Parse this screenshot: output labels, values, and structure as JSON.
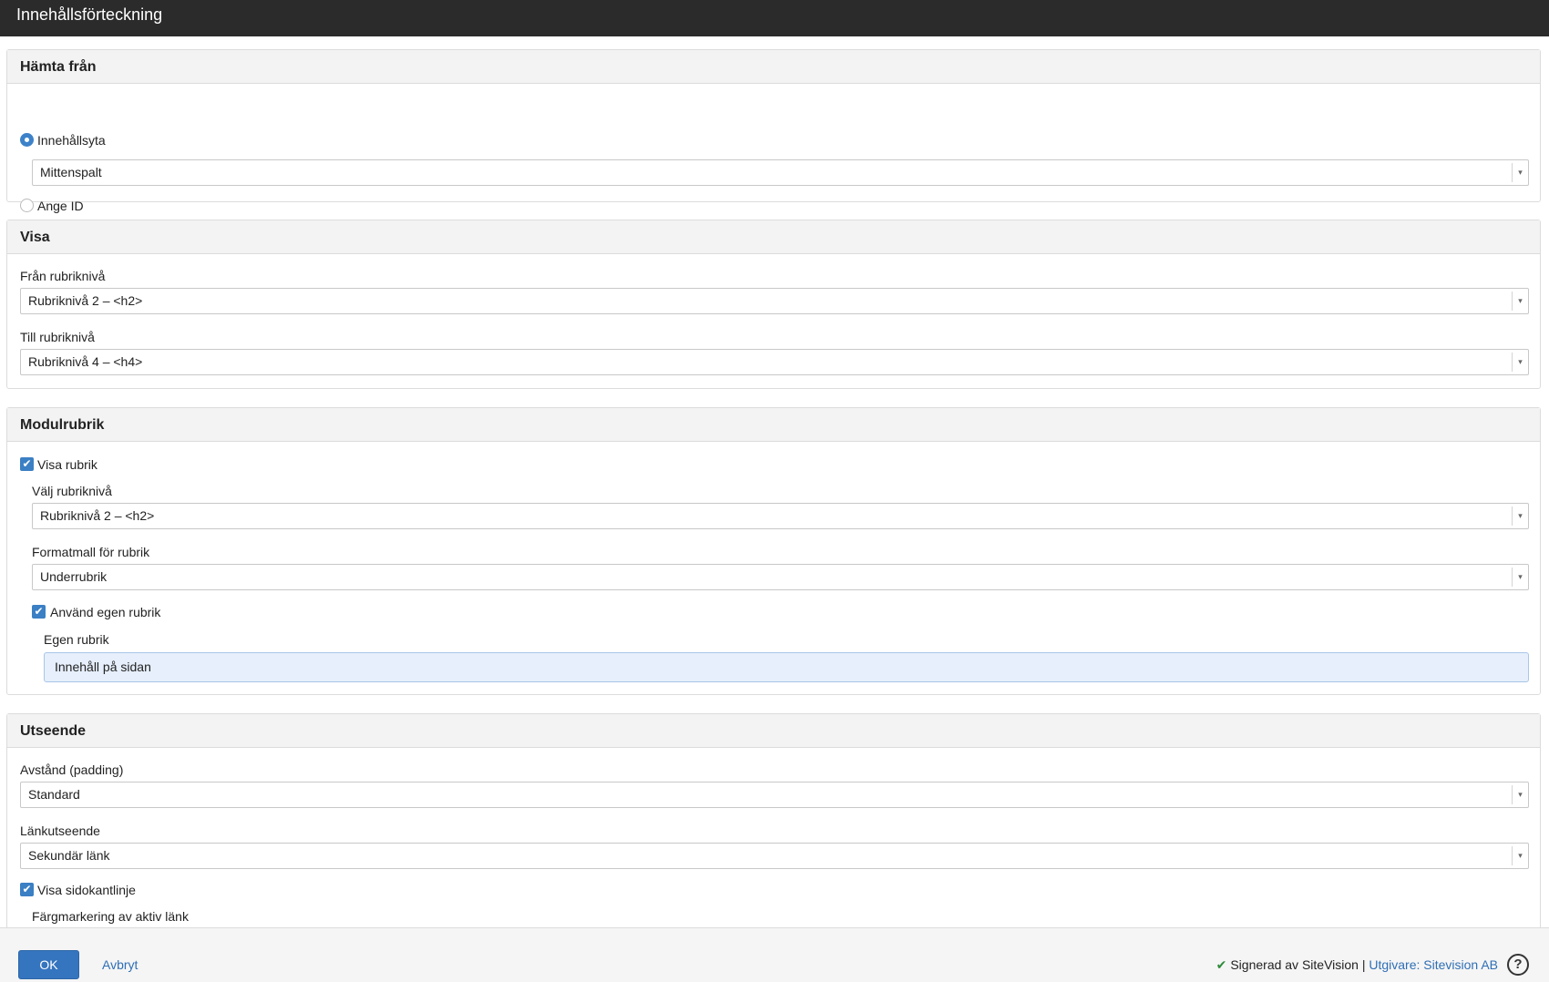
{
  "window": {
    "title": "Innehållsförteckning"
  },
  "source": {
    "heading": "Hämta från",
    "option_area_label": "Innehållsyta",
    "area_select_value": "Mittenspalt",
    "option_id_label": "Ange ID"
  },
  "display": {
    "heading": "Visa",
    "from_label": "Från rubriknivå",
    "from_value": "Rubriknivå 2 – <h2>",
    "to_label": "Till rubriknivå",
    "to_value": "Rubriknivå 4 – <h4>"
  },
  "module_heading": {
    "heading": "Modulrubrik",
    "show_heading_label": "Visa rubrik",
    "level_label": "Välj rubriknivå",
    "level_value": "Rubriknivå 2 – <h2>",
    "format_label": "Formatmall för rubrik",
    "format_value": "Underrubrik",
    "custom_check_label": "Använd egen rubrik",
    "custom_label": "Egen rubrik",
    "custom_value": "Innehåll på sidan"
  },
  "appearance": {
    "heading": "Utseende",
    "padding_label": "Avstånd (padding)",
    "padding_value": "Standard",
    "link_label": "Länkutseende",
    "link_value": "Sekundär länk",
    "sideline_label": "Visa sidokantlinje",
    "active_color_label": "Färgmarkering av aktiv länk"
  },
  "footer": {
    "ok_label": "OK",
    "cancel_label": "Avbryt",
    "signed_text": "Signerad av SiteVision",
    "separator": " | ",
    "publisher_link": "Utgivare: Sitevision AB",
    "help_glyph": "?"
  },
  "icons": {
    "select_arrow": "▾",
    "check": "✔"
  },
  "colors": {
    "titlebar": "#2b2b2b",
    "primary": "#3575bf",
    "link": "#2f6fb5",
    "checkmark_green": "#2e8b3a",
    "custom_field_bg": "#e6effb"
  }
}
